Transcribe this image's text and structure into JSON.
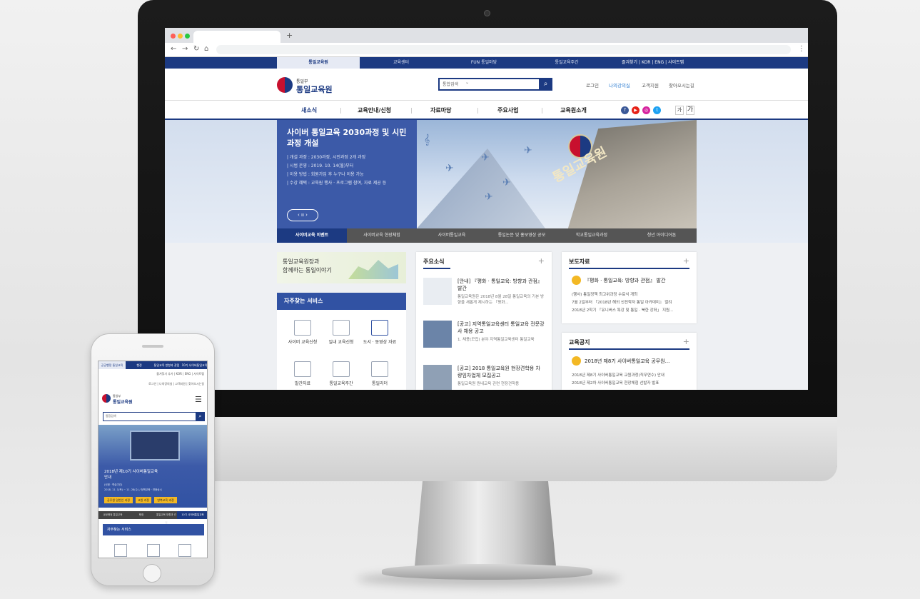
{
  "browser": {
    "new_tab": "+"
  },
  "util_bar": {
    "tabs": [
      "통일교육원",
      "교육센터",
      "FUN 통일마당",
      "통일교육주간"
    ],
    "right_links": [
      "즐겨찾기",
      "KOR",
      "ENG",
      "사이트맵"
    ]
  },
  "header": {
    "logo_small": "통일부",
    "logo_big": "통일교육원",
    "search_placeholder": "통합검색",
    "links": [
      "로그인",
      "나의강의실",
      "고객지원",
      "찾아오시는길"
    ]
  },
  "gnb": {
    "items": [
      "새소식",
      "교육안내/신청",
      "자료마당",
      "주요사업",
      "교육원소개"
    ],
    "font_buttons": [
      "가",
      "가"
    ]
  },
  "hero": {
    "title": "사이버 통일교육 2030과정 및 시민과정 개설",
    "lines": [
      "| 개설 과정 : 2030과정, 시민과정 2개 과정",
      "| 시범 운영 : 2019. 10. 14(월)부터",
      "| 이용 방법 : 회원가입 후 누구나 이용 가능",
      "| 수강 혜택 : 교육원 행사 · 프로그램 참여, 자료 제공 등"
    ],
    "control": "‹ ıı ›",
    "building_text": "통일교육원",
    "tabs": [
      "사이버교육 이벤트",
      "사이버교육 현장체험",
      "사이버통일교육",
      "통일논문 및 홍보영상 공모",
      "학교통일교육과정",
      "청년 아이디어톤"
    ]
  },
  "banner": {
    "line1": "통일교육원장과",
    "line2": "함께하는 통일이야기"
  },
  "frequent": {
    "title": "자주찾는 서비스",
    "items": [
      "사이버 교육신청",
      "일내 교육신청",
      "도서 · 동영상 자료",
      "발간자료",
      "통일교육주간",
      "통일리더"
    ]
  },
  "news": {
    "title": "주요소식",
    "plus": "+",
    "items": [
      {
        "title": "[안내] 『평화 · 통일교육: 방향과 관점』 발간",
        "desc": "통일교육원은 2018년 8월 28일 통일교육의 기본 방향을 새롭게 제시하는 『평화..."
      },
      {
        "title": "[공고] 지역통일교육센터 통일교육 전문강사 채용 공고",
        "desc": "1. 채용(모집) 분야 지역통일교육센터 통일교육"
      },
      {
        "title": "[공고] 2018 통일교육원 현장견학용 차량임차업체 모집공고",
        "desc": "통일교육원 원내교육 관련 현장견학용"
      }
    ]
  },
  "press": {
    "title": "보도자료",
    "plus": "+",
    "featured": "『평화 · 통일교육: 방향과 관점』 발간",
    "bullets": [
      "(행사) 통일정책 최고위과정 수료식 개최",
      "7월 2일부터 『2018년 해외 신진학자 통일 아카데미』 열려",
      "2018년 2학기 「유니버스 특강 및 통일 · 북한 강좌」 지원..."
    ]
  },
  "notice": {
    "title": "교육공지",
    "plus": "+",
    "featured": "2018년 제8기 사이버통일교육 공무원...",
    "bullets": [
      "2018년 제8기 사이버통일교육 교원과정(직무연수) 안내",
      "2018년 제2차 사이버통일교육 현장체험 선발자 발표"
    ]
  },
  "phone": {
    "tabs": [
      "공공행정 통일교육",
      "행정",
      "통일교육 방향과 관점",
      "10기 사이버통일교육"
    ],
    "row1": "즐겨찾기 추가 | KOR | ENG | 사이트맵",
    "row2": "로그인 | 나의강의실 | 고객지원 | 찾아오시는길",
    "logo_small": "통일부",
    "logo_big": "통일교육원",
    "search_placeholder": "통합검색",
    "hero_title": "2018년 제10기 사이버통일교육 안내",
    "hero_line1": "(신청 · 학습기간)",
    "hero_line2": "2018. 11. 1(목) ~ 11. 28(수) / 정책교육 · 연중상시",
    "buttons": [
      "공무원 일반인 과정",
      "교원 과정",
      "방북교육 과정"
    ],
    "freq_title": "자주찾는 서비스"
  }
}
